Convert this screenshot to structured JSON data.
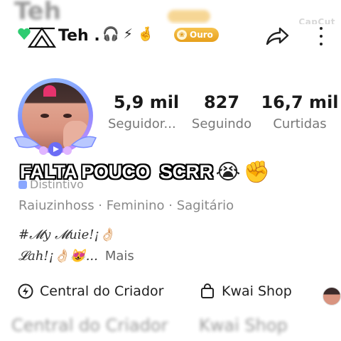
{
  "header": {
    "username": "Teh .",
    "emojis": [
      "🎧",
      "⚡",
      "🤞"
    ],
    "badge_label": "Ouro",
    "icons": [
      "green-heart-icon",
      "triangle-logo-icon",
      "share-icon",
      "more-icon"
    ]
  },
  "watermark": "CapCut",
  "stats": [
    {
      "value": "5,9 mil",
      "label": "Seguidor..."
    },
    {
      "value": "827",
      "label": "Seguindo"
    },
    {
      "value": "16,7 mil",
      "label": "Curtidas"
    }
  ],
  "overlay": {
    "text": "FALTA POUCO  SCRR",
    "emojis": [
      "😭",
      "✊"
    ]
  },
  "profile": {
    "distintivo": "Distintivo",
    "info_line": "Raiuzinhoss · Feminino · Sagitário",
    "bio_line1": "#𝓜y 𝓜uie!¡👌🏻",
    "bio_line2": "𝓛ah!¡👌🏻😻...",
    "more_label": "Mais"
  },
  "actions": {
    "creator_center": "Central do Criador",
    "kwai_shop": "Kwai Shop"
  },
  "ghost": {
    "top": "Teh",
    "bottom_left": "Central do Criador",
    "bottom_right": "Kwai Shop"
  },
  "colors": {
    "badge_gold": "#f0b02e",
    "stat_label": "#777777",
    "avatar_frame": "#7a8cff"
  }
}
